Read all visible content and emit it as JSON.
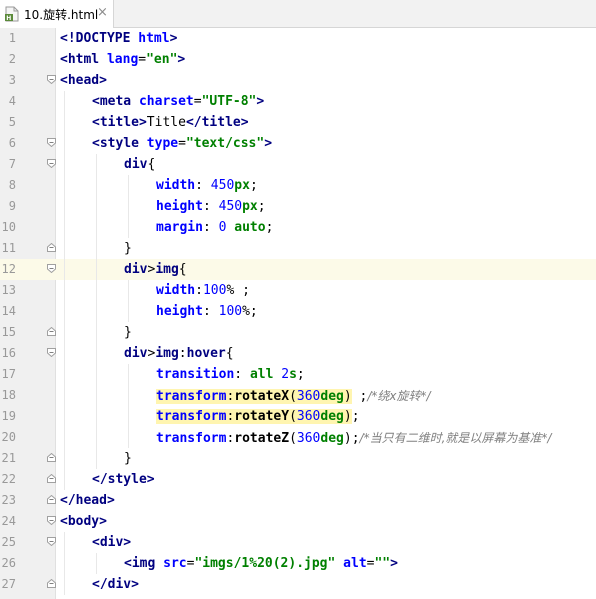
{
  "tab": {
    "title": "10.旋转.html",
    "close": "×"
  },
  "lines": [
    {
      "n": "1",
      "indent": 0,
      "fold": "none",
      "parts": [
        [
          "tag",
          "<!DOCTYPE "
        ],
        [
          "attr",
          "html"
        ],
        [
          "tag",
          ">"
        ]
      ]
    },
    {
      "n": "2",
      "indent": 0,
      "fold": "none",
      "parts": [
        [
          "tag",
          "<html "
        ],
        [
          "attr",
          "lang"
        ],
        [
          "plain",
          "="
        ],
        [
          "str",
          "\"en\""
        ],
        [
          "tag",
          ">"
        ]
      ]
    },
    {
      "n": "3",
      "indent": 0,
      "fold": "open",
      "parts": [
        [
          "tag",
          "<head>"
        ]
      ]
    },
    {
      "n": "4",
      "indent": 1,
      "fold": "none",
      "parts": [
        [
          "tag",
          "<meta "
        ],
        [
          "attr",
          "charset"
        ],
        [
          "plain",
          "="
        ],
        [
          "str",
          "\"UTF-8\""
        ],
        [
          "tag",
          ">"
        ]
      ]
    },
    {
      "n": "5",
      "indent": 1,
      "fold": "none",
      "parts": [
        [
          "tag",
          "<title>"
        ],
        [
          "plain",
          "Title"
        ],
        [
          "tag",
          "</title>"
        ]
      ]
    },
    {
      "n": "6",
      "indent": 1,
      "fold": "open",
      "parts": [
        [
          "tag",
          "<style "
        ],
        [
          "attr",
          "type"
        ],
        [
          "plain",
          "="
        ],
        [
          "str",
          "\"text/css\""
        ],
        [
          "tag",
          ">"
        ]
      ]
    },
    {
      "n": "7",
      "indent": 2,
      "fold": "open",
      "parts": [
        [
          "tag",
          "div"
        ],
        [
          "plain",
          "{"
        ]
      ]
    },
    {
      "n": "8",
      "indent": 3,
      "fold": "none",
      "parts": [
        [
          "prop",
          "width"
        ],
        [
          "plain",
          ": "
        ],
        [
          "num",
          "450"
        ],
        [
          "kw",
          "px"
        ],
        [
          "plain",
          ";"
        ]
      ]
    },
    {
      "n": "9",
      "indent": 3,
      "fold": "none",
      "parts": [
        [
          "prop",
          "height"
        ],
        [
          "plain",
          ": "
        ],
        [
          "num",
          "450"
        ],
        [
          "kw",
          "px"
        ],
        [
          "plain",
          ";"
        ]
      ]
    },
    {
      "n": "10",
      "indent": 3,
      "fold": "none",
      "parts": [
        [
          "prop",
          "margin"
        ],
        [
          "plain",
          ": "
        ],
        [
          "num",
          "0"
        ],
        [
          "plain",
          " "
        ],
        [
          "kw",
          "auto"
        ],
        [
          "plain",
          ";"
        ]
      ]
    },
    {
      "n": "11",
      "indent": 2,
      "fold": "close",
      "parts": [
        [
          "plain",
          "}"
        ]
      ]
    },
    {
      "n": "12",
      "indent": 2,
      "fold": "open",
      "current": true,
      "parts": [
        [
          "tag",
          "div"
        ],
        [
          "plain",
          ">"
        ],
        [
          "tag",
          "img"
        ],
        [
          "plain",
          "{"
        ]
      ]
    },
    {
      "n": "13",
      "indent": 3,
      "fold": "none",
      "parts": [
        [
          "prop",
          "width"
        ],
        [
          "plain",
          ":"
        ],
        [
          "num",
          "100"
        ],
        [
          "plain",
          "% ;"
        ]
      ]
    },
    {
      "n": "14",
      "indent": 3,
      "fold": "none",
      "parts": [
        [
          "prop",
          "height"
        ],
        [
          "plain",
          ": "
        ],
        [
          "num",
          "100"
        ],
        [
          "plain",
          "%;"
        ]
      ]
    },
    {
      "n": "15",
      "indent": 2,
      "fold": "close",
      "parts": [
        [
          "plain",
          "}"
        ]
      ]
    },
    {
      "n": "16",
      "indent": 2,
      "fold": "open",
      "parts": [
        [
          "tag",
          "div"
        ],
        [
          "plain",
          ">"
        ],
        [
          "tag",
          "img"
        ],
        [
          "plain",
          ":"
        ],
        [
          "tag",
          "hover"
        ],
        [
          "plain",
          "{"
        ]
      ]
    },
    {
      "n": "17",
      "indent": 3,
      "fold": "none",
      "parts": [
        [
          "prop",
          "transition"
        ],
        [
          "plain",
          ": "
        ],
        [
          "kw",
          "all"
        ],
        [
          "plain",
          " "
        ],
        [
          "num",
          "2"
        ],
        [
          "kw",
          "s"
        ],
        [
          "plain",
          ";"
        ]
      ]
    },
    {
      "n": "18",
      "indent": 3,
      "fold": "none",
      "parts": [
        [
          "prop hl",
          "transform"
        ],
        [
          "plain hl",
          ":"
        ],
        [
          "fn hl",
          "rotateX"
        ],
        [
          "plain hl",
          "("
        ],
        [
          "num hl",
          "360"
        ],
        [
          "kw hl",
          "deg"
        ],
        [
          "plain hl",
          ")"
        ],
        [
          "plain",
          " ;"
        ],
        [
          "cmt",
          "/*绕x旋转*/"
        ]
      ]
    },
    {
      "n": "19",
      "indent": 3,
      "fold": "none",
      "parts": [
        [
          "prop hl",
          "transform"
        ],
        [
          "plain hl",
          ":"
        ],
        [
          "fn hl",
          "rotateY"
        ],
        [
          "plain hl",
          "("
        ],
        [
          "num hl",
          "360"
        ],
        [
          "kw hl",
          "deg"
        ],
        [
          "plain hl",
          ")"
        ],
        [
          "plain",
          ";"
        ]
      ]
    },
    {
      "n": "20",
      "indent": 3,
      "fold": "none",
      "parts": [
        [
          "prop",
          "transform"
        ],
        [
          "plain",
          ":"
        ],
        [
          "fn",
          "rotateZ"
        ],
        [
          "plain",
          "("
        ],
        [
          "num",
          "360"
        ],
        [
          "kw",
          "deg"
        ],
        [
          "plain",
          ");"
        ],
        [
          "cmt",
          "/*当只有二维时,就是以屏幕为基准*/"
        ]
      ]
    },
    {
      "n": "21",
      "indent": 2,
      "fold": "close",
      "parts": [
        [
          "plain",
          "}"
        ]
      ]
    },
    {
      "n": "22",
      "indent": 1,
      "fold": "close",
      "parts": [
        [
          "tag",
          "</style>"
        ]
      ]
    },
    {
      "n": "23",
      "indent": 0,
      "fold": "close",
      "parts": [
        [
          "tag",
          "</head>"
        ]
      ]
    },
    {
      "n": "24",
      "indent": 0,
      "fold": "open",
      "parts": [
        [
          "tag",
          "<body>"
        ]
      ]
    },
    {
      "n": "25",
      "indent": 1,
      "fold": "open",
      "parts": [
        [
          "tag",
          "<div>"
        ]
      ]
    },
    {
      "n": "26",
      "indent": 2,
      "fold": "none",
      "parts": [
        [
          "tag",
          "<img "
        ],
        [
          "attr",
          "src"
        ],
        [
          "plain",
          "="
        ],
        [
          "str",
          "\"imgs/1%20(2).jpg\""
        ],
        [
          "plain",
          " "
        ],
        [
          "attr",
          "alt"
        ],
        [
          "plain",
          "="
        ],
        [
          "str",
          "\"\""
        ],
        [
          "tag",
          ">"
        ]
      ]
    },
    {
      "n": "27",
      "indent": 1,
      "fold": "close",
      "parts": [
        [
          "tag",
          "</div>"
        ]
      ]
    }
  ],
  "colors": {
    "gutter": "#f0f0f0",
    "current_line": "#fcfae8",
    "tag": "#000080",
    "string": "#008000",
    "property": "#0000ff",
    "comment": "#808080"
  }
}
